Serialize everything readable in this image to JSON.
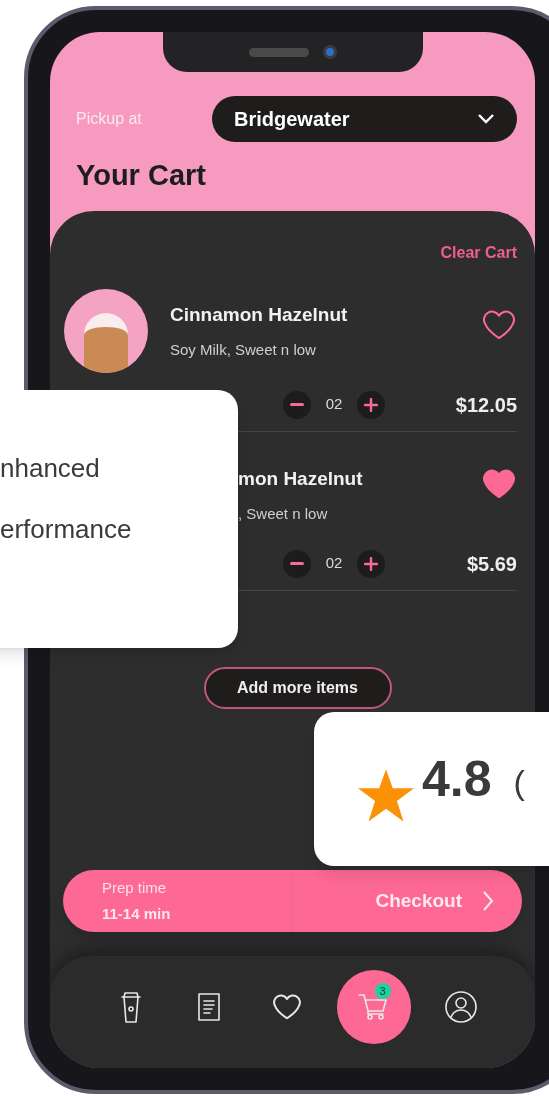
{
  "header": {
    "pickup_label": "Pickup at",
    "location": "Bridgewater",
    "title": "Your Cart"
  },
  "cart": {
    "clear_label": "Clear Cart",
    "items": [
      {
        "name": "Cinnamon Hazelnut",
        "options": "Soy Milk, Sweet n low",
        "quantity": "02",
        "price": "$12.05",
        "liked": false,
        "kind": "full"
      },
      {
        "name": "mon Hazelnut",
        "options": ", Sweet n low",
        "quantity": "02",
        "price": "$5.69",
        "liked": true,
        "kind": "partial"
      }
    ],
    "add_more_label": "Add more items"
  },
  "checkout": {
    "prep_label": "Prep time",
    "prep_time": "11-14 min",
    "button": "Checkout"
  },
  "nav": [
    {
      "kind": "cup",
      "selected": false
    },
    {
      "kind": "receipt",
      "selected": false
    },
    {
      "kind": "heart",
      "selected": false
    },
    {
      "kind": "cart",
      "selected": true,
      "badge": "3"
    },
    {
      "kind": "profile",
      "selected": false
    }
  ],
  "overlays": {
    "feature_card": {
      "lines": [
        "nhanced",
        "erformance"
      ]
    },
    "rating_card": {
      "rating": "4.8",
      "suffix": "("
    }
  }
}
